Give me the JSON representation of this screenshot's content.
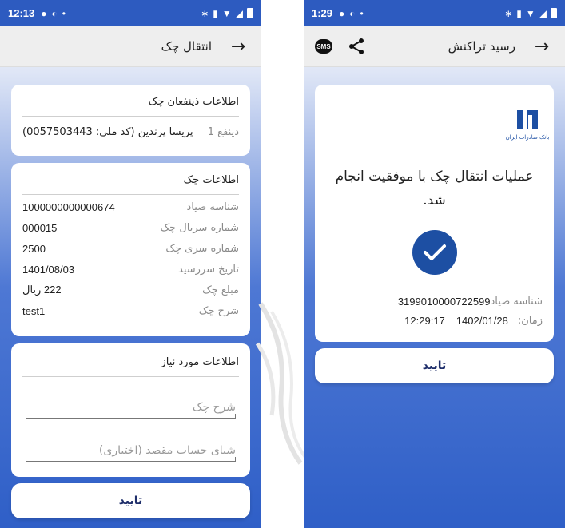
{
  "left": {
    "status": {
      "time": "12:13"
    },
    "appbar": {
      "title": "انتقال چک",
      "back_icon": "arrow-right-icon"
    },
    "payee_card": {
      "heading": "اطلاعات ذینفعان چک",
      "label": "ذینفع 1",
      "value": "پریسا پرندین (کد ملی: 0057503443)"
    },
    "check_card": {
      "heading": "اطلاعات چک",
      "rows": [
        {
          "label": "شناسه صیاد",
          "value": "1000000000000674"
        },
        {
          "label": "شماره سریال چک",
          "value": "000015"
        },
        {
          "label": "شماره سری چک",
          "value": "2500"
        },
        {
          "label": "تاریخ سررسید",
          "value": "1401/08/03"
        },
        {
          "label": "مبلغ چک",
          "value": "222 ریال"
        },
        {
          "label": "شرح چک",
          "value": "test1"
        }
      ]
    },
    "required_card": {
      "heading": "اطلاعات مورد نیاز",
      "description_placeholder": "شرح چک",
      "iban_placeholder": "شبای حساب مقصد (اختیاری)"
    },
    "confirm_label": "تایید"
  },
  "right": {
    "status": {
      "time": "1:29"
    },
    "appbar": {
      "title": "رسید تراکنش",
      "share_icon": "share-icon",
      "sms_icon": "sms-icon",
      "sms_label": "SMS"
    },
    "receipt": {
      "bank_name": "بانک صادرات ایران",
      "message": "عملیات انتقال چک با موفقیت انجام شد.",
      "sayad_label": "شناسه صیاد",
      "sayad_value": "3199010000722599",
      "time_label": "زمان:",
      "date_value": "1402/01/28",
      "time_value": "12:29:17"
    },
    "confirm_label": "تایید"
  },
  "colors": {
    "primary": "#2d5bc0",
    "bank_blue": "#1d4fa3",
    "button_text": "#1f2f6b"
  }
}
